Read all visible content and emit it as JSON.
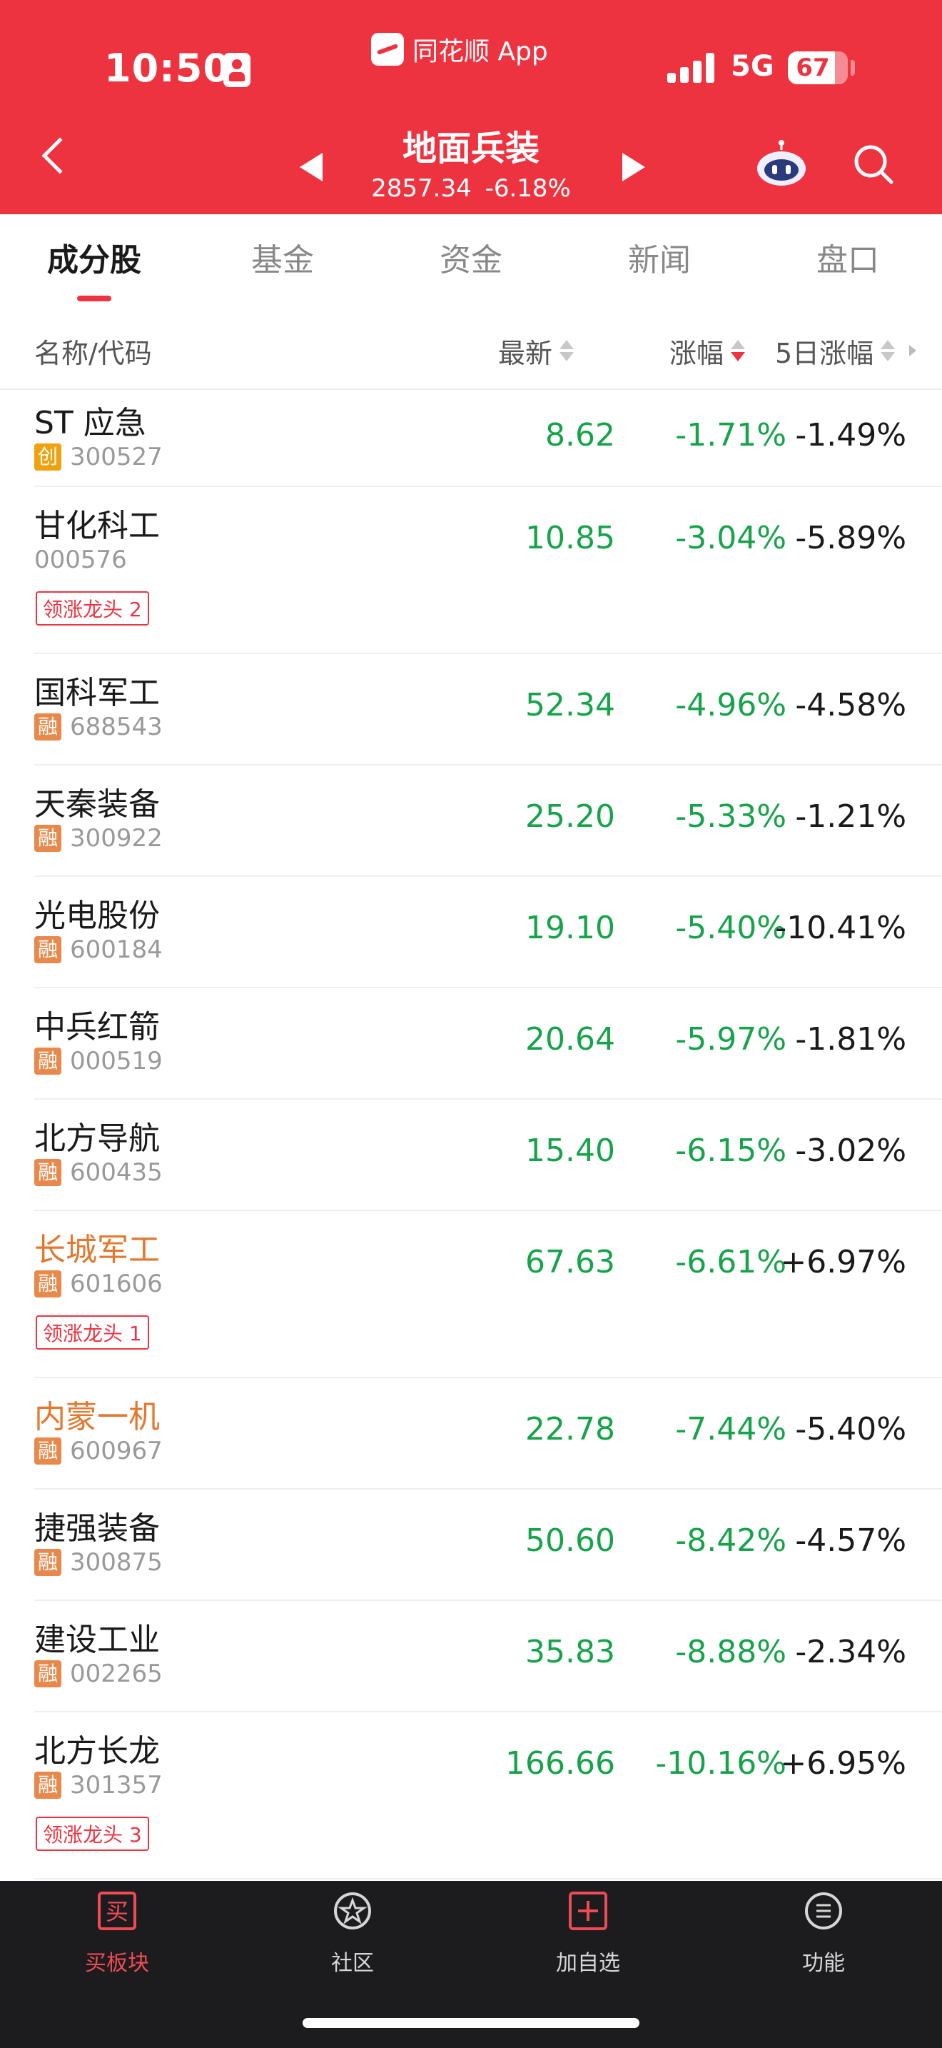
{
  "status_bar": {
    "time": "10:50",
    "network": "5G",
    "battery": "67",
    "app_name": "同花顺 App"
  },
  "header": {
    "title": "地面兵装",
    "index_value": "2857.34",
    "index_change": "-6.18%"
  },
  "tabs": [
    "成分股",
    "基金",
    "资金",
    "新闻",
    "盘口"
  ],
  "columns": {
    "name": "名称/代码",
    "price": "最新",
    "change": "涨幅",
    "change5": "5日涨幅"
  },
  "rows": [
    {
      "name": "ST 应急",
      "tag": "创",
      "code": "300527",
      "price": "8.62",
      "change": "-1.71%",
      "change5": "-1.49%",
      "badge": ""
    },
    {
      "name": "甘化科工",
      "tag": "",
      "code": "000576",
      "price": "10.85",
      "change": "-3.04%",
      "change5": "-5.89%",
      "badge": "领涨龙头 2"
    },
    {
      "name": "国科军工",
      "tag": "融",
      "code": "688543",
      "price": "52.34",
      "change": "-4.96%",
      "change5": "-4.58%",
      "badge": ""
    },
    {
      "name": "天秦装备",
      "tag": "融",
      "code": "300922",
      "price": "25.20",
      "change": "-5.33%",
      "change5": "-1.21%",
      "badge": ""
    },
    {
      "name": "光电股份",
      "tag": "融",
      "code": "600184",
      "price": "19.10",
      "change": "-5.40%",
      "change5": "-10.41%",
      "badge": ""
    },
    {
      "name": "中兵红箭",
      "tag": "融",
      "code": "000519",
      "price": "20.64",
      "change": "-5.97%",
      "change5": "-1.81%",
      "badge": ""
    },
    {
      "name": "北方导航",
      "tag": "融",
      "code": "600435",
      "price": "15.40",
      "change": "-6.15%",
      "change5": "-3.02%",
      "badge": ""
    },
    {
      "name": "长城军工",
      "tag": "融",
      "code": "601606",
      "price": "67.63",
      "change": "-6.61%",
      "change5": "+6.97%",
      "badge": "领涨龙头 1"
    },
    {
      "name": "内蒙一机",
      "tag": "融",
      "code": "600967",
      "price": "22.78",
      "change": "-7.44%",
      "change5": "-5.40%",
      "badge": ""
    },
    {
      "name": "捷强装备",
      "tag": "融",
      "code": "300875",
      "price": "50.60",
      "change": "-8.42%",
      "change5": "-4.57%",
      "badge": ""
    },
    {
      "name": "建设工业",
      "tag": "融",
      "code": "002265",
      "price": "35.83",
      "change": "-8.88%",
      "change5": "-2.34%",
      "badge": ""
    },
    {
      "name": "北方长龙",
      "tag": "融",
      "code": "301357",
      "price": "166.66",
      "change": "-10.16%",
      "change5": "+6.95%",
      "badge": "领涨龙头 3"
    }
  ],
  "bottom_nav": [
    {
      "label": "买板块",
      "icon": "buy-icon"
    },
    {
      "label": "社区",
      "icon": "community-icon"
    },
    {
      "label": "加自选",
      "icon": "add-watchlist-icon"
    },
    {
      "label": "功能",
      "icon": "menu-icon"
    }
  ],
  "colors": {
    "header_red": "#ee3340",
    "down_green": "#16a34a",
    "leader_orange": "#e3782e",
    "tag_chuang": "#f2a10e",
    "tag_rong": "#e8894b"
  }
}
